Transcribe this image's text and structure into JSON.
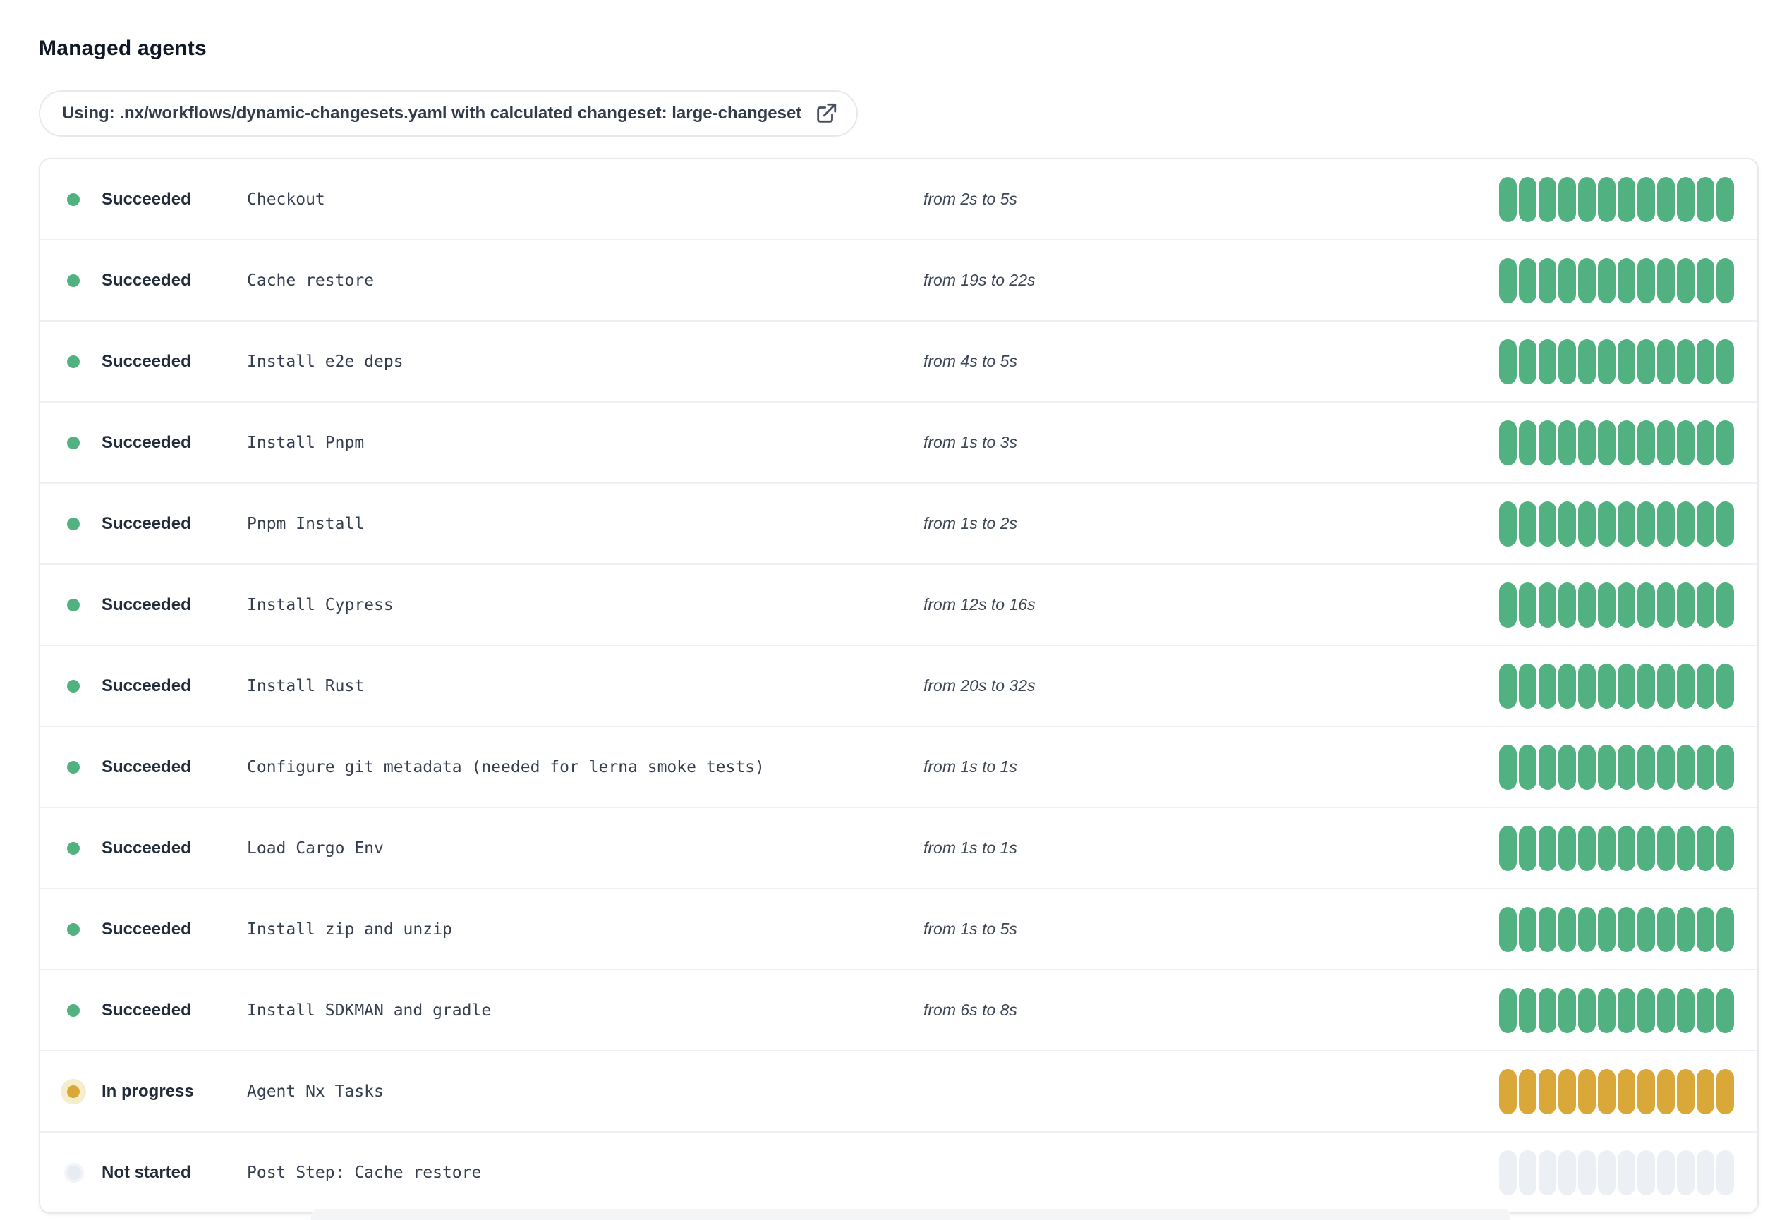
{
  "page": {
    "title": "Managed agents"
  },
  "banner": {
    "text": "Using: .nx/workflows/dynamic-changesets.yaml with calculated changeset: large-changeset",
    "icon": "external-link-icon"
  },
  "colors": {
    "succeeded": "#52b180",
    "in_progress": "#d9a838",
    "in_progress_halo": "#f5edcb",
    "not_started": "#e7ecf2",
    "not_started_bar": "#ecf0f4",
    "border": "#e7e9ed",
    "divider": "#eef0f3"
  },
  "agents": {
    "segments_per_bar": 12,
    "rows": [
      {
        "status": "Succeeded",
        "state": "succeeded",
        "step": "Checkout",
        "duration": "from 2s to 5s"
      },
      {
        "status": "Succeeded",
        "state": "succeeded",
        "step": "Cache restore",
        "duration": "from 19s to 22s"
      },
      {
        "status": "Succeeded",
        "state": "succeeded",
        "step": "Install e2e deps",
        "duration": "from 4s to 5s"
      },
      {
        "status": "Succeeded",
        "state": "succeeded",
        "step": "Install Pnpm",
        "duration": "from 1s to 3s"
      },
      {
        "status": "Succeeded",
        "state": "succeeded",
        "step": "Pnpm Install",
        "duration": "from 1s to 2s"
      },
      {
        "status": "Succeeded",
        "state": "succeeded",
        "step": "Install Cypress",
        "duration": "from 12s to 16s"
      },
      {
        "status": "Succeeded",
        "state": "succeeded",
        "step": "Install Rust",
        "duration": "from 20s to 32s"
      },
      {
        "status": "Succeeded",
        "state": "succeeded",
        "step": "Configure git metadata (needed for lerna smoke tests)",
        "duration": "from 1s to 1s"
      },
      {
        "status": "Succeeded",
        "state": "succeeded",
        "step": "Load Cargo Env",
        "duration": "from 1s to 1s"
      },
      {
        "status": "Succeeded",
        "state": "succeeded",
        "step": "Install zip and unzip",
        "duration": "from 1s to 5s"
      },
      {
        "status": "Succeeded",
        "state": "succeeded",
        "step": "Install SDKMAN and gradle",
        "duration": "from 6s to 8s"
      },
      {
        "status": "In progress",
        "state": "in-progress",
        "step": "Agent Nx Tasks",
        "duration": ""
      },
      {
        "status": "Not started",
        "state": "not-started",
        "step": "Post Step: Cache restore",
        "duration": ""
      }
    ]
  }
}
